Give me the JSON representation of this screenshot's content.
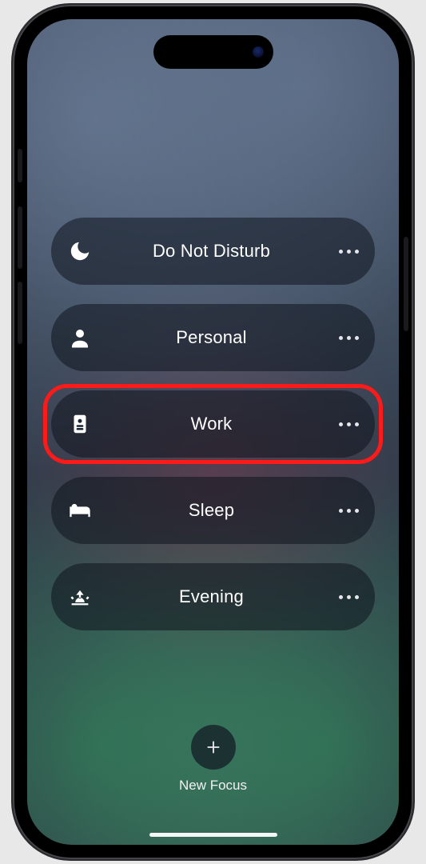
{
  "focus": {
    "items": [
      {
        "id": "do-not-disturb",
        "icon": "moon",
        "label": "Do Not Disturb",
        "highlight": false
      },
      {
        "id": "personal",
        "icon": "person",
        "label": "Personal",
        "highlight": false
      },
      {
        "id": "work",
        "icon": "badge",
        "label": "Work",
        "highlight": true
      },
      {
        "id": "sleep",
        "icon": "bed",
        "label": "Sleep",
        "highlight": false
      },
      {
        "id": "evening",
        "icon": "sunset",
        "label": "Evening",
        "highlight": false
      }
    ],
    "new_label": "New Focus"
  }
}
